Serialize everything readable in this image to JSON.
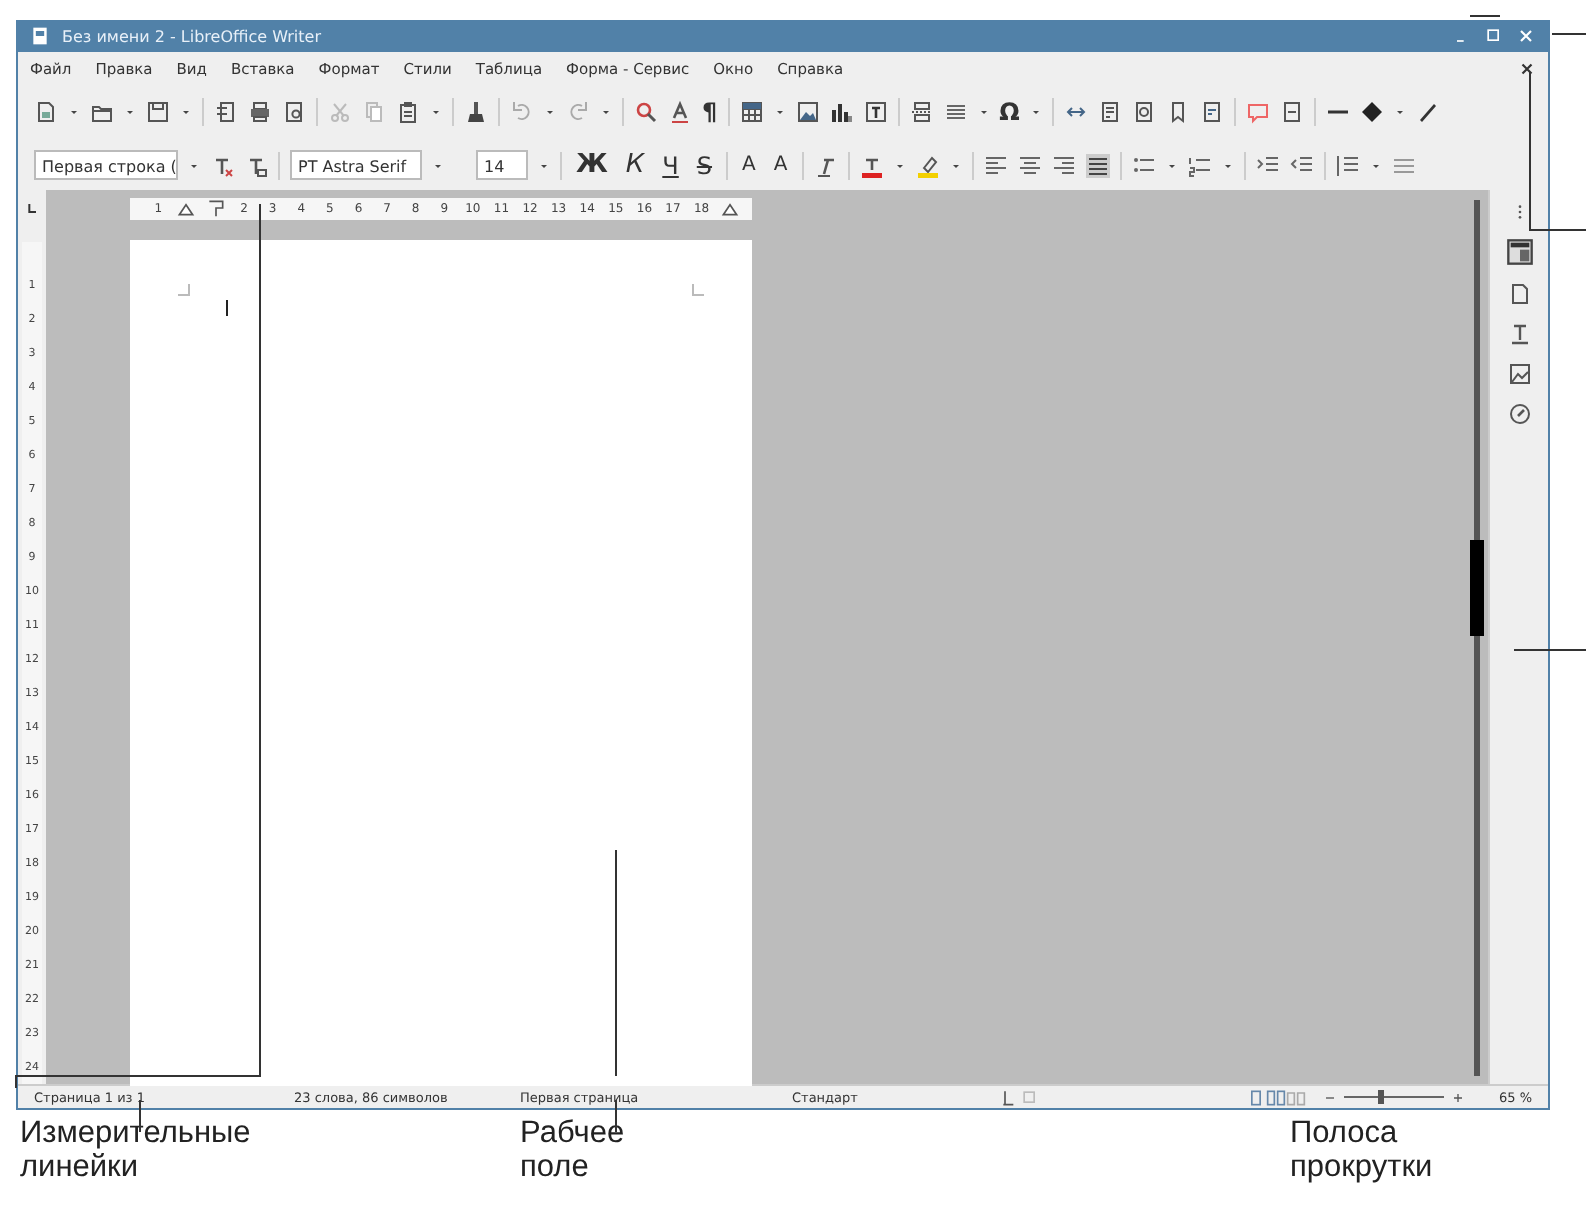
{
  "window": {
    "title": "Без имени 2 - LibreOffice Writer"
  },
  "menu": [
    "Файл",
    "Правка",
    "Вид",
    "Вставка",
    "Формат",
    "Стили",
    "Таблица",
    "Форма - Сервис",
    "Окно",
    "Справка"
  ],
  "standard_toolbar": {
    "glyphs": [
      "¶",
      "Ω"
    ]
  },
  "formatting_toolbar": {
    "paragraph_style": "Первая строка (",
    "font_name": "PT Astra Serif",
    "font_size": "14",
    "format_buttons": [
      {
        "text": "Ж",
        "kind": "bold"
      },
      {
        "text": "К",
        "kind": "italic"
      },
      {
        "text": "Ч",
        "kind": "underline"
      },
      {
        "text": "S",
        "kind": "strike"
      },
      {
        "text": "A",
        "kind": "superscript"
      },
      {
        "text": "A",
        "kind": "subscript"
      }
    ]
  },
  "ruler": {
    "numbers": [
      "1",
      "2",
      "3",
      "4",
      "5",
      "6",
      "7",
      "8",
      "9",
      "10",
      "11",
      "12",
      "13",
      "14",
      "15",
      "16",
      "17",
      "18"
    ],
    "vertical_numbers": [
      "1",
      "2",
      "3",
      "4",
      "5",
      "6",
      "7",
      "8",
      "9",
      "10",
      "11",
      "12",
      "13",
      "14",
      "15",
      "16",
      "17",
      "18",
      "19",
      "20",
      "21",
      "22",
      "23",
      "24"
    ]
  },
  "status_bar": {
    "page": "Страница 1 из 1",
    "words": "23 слова, 86 символов",
    "page_style": "Первая страница",
    "language": "Стандарт",
    "zoom": "65 %",
    "zoom_slider": {
      "level": 0.35
    }
  },
  "annotations": [
    {
      "text": "Измерительные линейки"
    },
    {
      "text": "Рабчее поле"
    },
    {
      "text": "Полоса прокрутки"
    }
  ]
}
